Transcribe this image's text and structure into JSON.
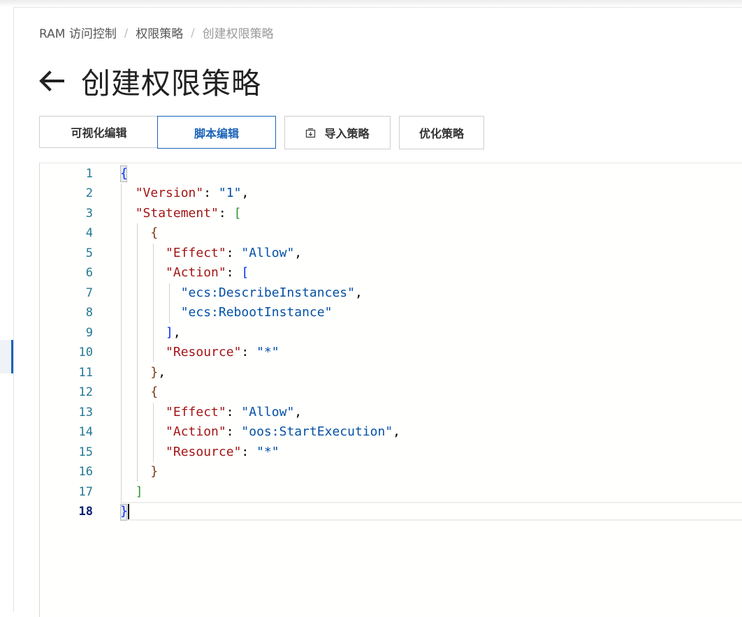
{
  "breadcrumb": {
    "items": [
      "RAM 访问控制",
      "权限策略",
      "创建权限策略"
    ],
    "separator": "/"
  },
  "page": {
    "title": "创建权限策略",
    "back_icon": "arrow-left-icon"
  },
  "tabs": [
    {
      "label": "可视化编辑",
      "active": false
    },
    {
      "label": "脚本编辑",
      "active": true
    }
  ],
  "actions": {
    "import_label": "导入策略",
    "import_icon": "import-icon",
    "optimize_label": "优化策略"
  },
  "editor": {
    "active_line": 18,
    "line_numbers": [
      "1",
      "2",
      "3",
      "4",
      "5",
      "6",
      "7",
      "8",
      "9",
      "10",
      "11",
      "12",
      "13",
      "14",
      "15",
      "16",
      "17",
      "18"
    ],
    "lines": [
      "{",
      "  \"Version\": \"1\",",
      "  \"Statement\": [",
      "    {",
      "      \"Effect\": \"Allow\",",
      "      \"Action\": [",
      "        \"ecs:DescribeInstances\",",
      "        \"ecs:RebootInstance\"",
      "      ],",
      "      \"Resource\": \"*\"",
      "    },",
      "    {",
      "      \"Effect\": \"Allow\",",
      "      \"Action\": \"oos:StartExecution\",",
      "      \"Resource\": \"*\"",
      "    }",
      "  ]",
      "}"
    ],
    "tokens": {
      "version_key": "\"Version\"",
      "version_val": "\"1\"",
      "statement_key": "\"Statement\"",
      "effect_key": "\"Effect\"",
      "allow_val": "\"Allow\"",
      "action_key": "\"Action\"",
      "action1": "\"ecs:DescribeInstances\"",
      "action2": "\"ecs:RebootInstance\"",
      "resource_key": "\"Resource\"",
      "star_val": "\"*\"",
      "oos_action": "\"oos:StartExecution\""
    }
  },
  "colors": {
    "accent": "#1a63b8",
    "json_key": "#a31515",
    "json_string": "#0451a5",
    "bracket_level1": "#0431fa",
    "bracket_level2": "#319331",
    "bracket_level3": "#7b3814",
    "line_number": "#237893"
  }
}
